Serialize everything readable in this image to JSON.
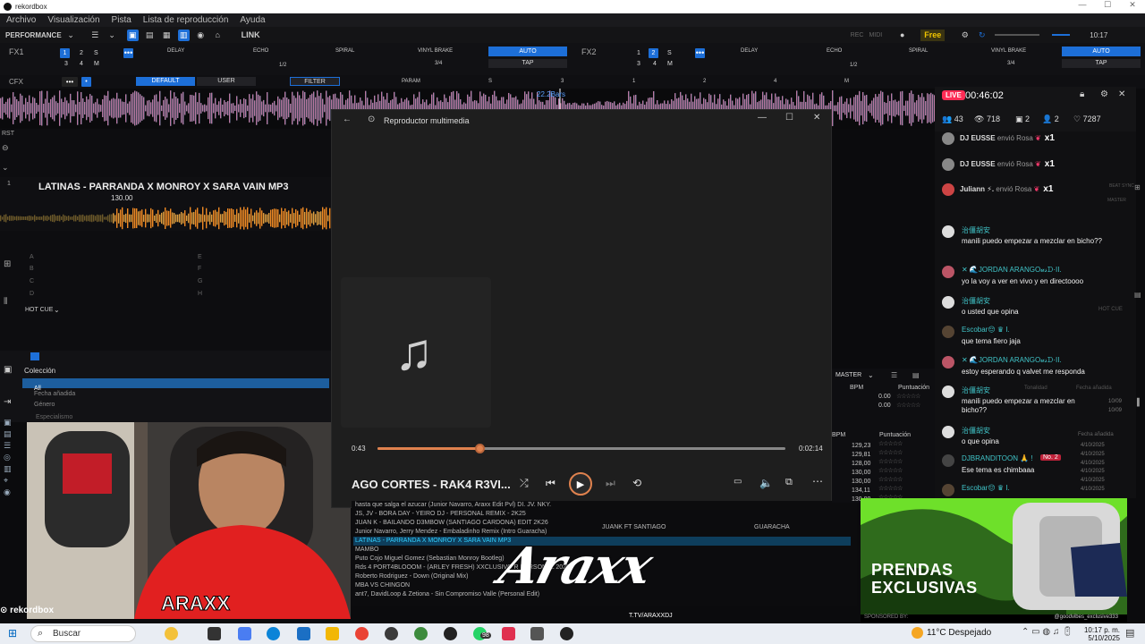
{
  "window": {
    "title": "rekordbox",
    "controls": [
      "—",
      "☐",
      "✕"
    ]
  },
  "menu": [
    "Archivo",
    "Visualización",
    "Pista",
    "Lista de reproducción",
    "Ayuda"
  ],
  "toolbar": {
    "mode": "PERFORMANCE",
    "link": "LINK",
    "free": "Free",
    "time": "10:17",
    "rec_label": "REC",
    "midi_label": "MIDI"
  },
  "fx1": {
    "label": "FX1",
    "effects": [
      "DELAY",
      "ECHO",
      "SPIRAL"
    ],
    "brake": "VINYL BRAKE",
    "auto": "AUTO",
    "tap": "TAP",
    "beat": "1/2",
    "beat2": "3/4",
    "nums": [
      "1",
      "2",
      "S",
      "3",
      "4",
      "M"
    ]
  },
  "fx2": {
    "label": "FX2",
    "effects": [
      "DELAY",
      "ECHO",
      "SPIRAL"
    ],
    "brake": "VINYL BRAKE",
    "auto": "AUTO",
    "tap": "TAP",
    "beat": "1/2",
    "beat2": "3/4"
  },
  "cfx": {
    "label": "CFX",
    "default": "DEFAULT",
    "user": "USER",
    "filter": "FILTER",
    "param": "PARAM",
    "s": "S",
    "m": "M",
    "bars": "22.2Bars",
    "nums": [
      "3",
      "1",
      "2",
      "4"
    ]
  },
  "deck": {
    "number": "1",
    "title": "LATINAS - PARRANDA X MONROY X SARA VAIN MP3",
    "bpm": "130.00",
    "hot_cue": "HOT CUE",
    "ab_left": [
      "A",
      "B",
      "C",
      "D"
    ],
    "ab_right": [
      "E",
      "F",
      "G",
      "H"
    ],
    "rst": "RST"
  },
  "collection": {
    "label": "Colección",
    "items": [
      "All",
      "Fecha añadida",
      "Género"
    ],
    "partial": "Especialismo"
  },
  "player": {
    "title": "Reproductor multimedia",
    "song": "AGO CORTES - RAK4 R3VI...",
    "elapsed": "0:43",
    "total": "0:02:14",
    "progress": 0.25
  },
  "tracklist": {
    "rows": [
      "hasta que salga el azucar (Junior Navarro, Araxx Edit Pvl) DI. JV. NKY.",
      "JS, JV - BORA DAY - YEIRO DJ - PERSONAL REMIX - 2K25",
      "JUAN K - BAILANDO D3MBOW (SANTIAGO CARDONA) EDIT 2K26",
      "Junior Navarro, Jerry Mendez - Embaladinho Remix (Intro Guaracha)",
      "LATINAS - PARRANDA X MONROY X SARA VAIN MP3",
      "MAMBO",
      "Puto Cojo Miguel Gomez (Sebastian Monroy Bootleg)",
      "Rds 4 PORT4BLOOOM - (ARLEY FRESH) XXCLUSIVO R PERSONAL 2025",
      "Roberto Rodriguez - Down (Original Mix)",
      "MBA VS CHINGON",
      "ant7, DavidLoop & Zetiona - Sin Compromiso Valle (Personal Edit)"
    ],
    "selected_index": 4,
    "artist_col": "JUANK FT SANTIAGO",
    "genre_col": "GUARACHA"
  },
  "browser": {
    "master": "MASTER",
    "bpm_header": "BPM",
    "rating_header": "Puntuación",
    "bpm_top": [
      "0.00",
      "0.00"
    ],
    "bpm_values": [
      "129,23",
      "129,81",
      "128,00",
      "130,00",
      "130,00",
      "134,11",
      "130,00"
    ],
    "dates_top": [
      "10/09",
      "10/09"
    ],
    "date_header": "Fecha añadida",
    "dates": [
      "4/10/2025",
      "4/10/2025",
      "4/10/2025",
      "4/10/2025",
      "4/10/2025",
      "4/10/2025",
      "4/10/2025"
    ],
    "tonality_header": "Tonalidad",
    "beat_sync": "BEAT SYNC",
    "master_small": "MASTER"
  },
  "live": {
    "badge": "LIVE",
    "timer": "00:46:02",
    "stats": {
      "viewers": "43",
      "views": "718",
      "shares": "2",
      "users": "2",
      "likes": "7287"
    },
    "gifts": [
      {
        "name": "DJ EUSSE",
        "text": "envió Rosa",
        "count": "x1"
      },
      {
        "name": "DJ EUSSE",
        "text": "envió Rosa",
        "count": "x1"
      },
      {
        "name": "Juliann ⚡.",
        "text": "envió Rosa",
        "count": "x1"
      }
    ],
    "messages": [
      {
        "name": "治僵胡安",
        "text": "manili puedo empezar a mezclar en bicho??"
      },
      {
        "name": "✕ 🌊JORDAN ARANGO𝓊𝓈ᗪ·II.",
        "text": "yo la voy a ver en vivo y en directoooo"
      },
      {
        "name": "治僵胡安",
        "text": "o usted que opina"
      },
      {
        "name": "Escobar😔 ♛ I.",
        "text": "que tema fiero jaja"
      },
      {
        "name": "✕ 🌊JORDAN ARANGO𝓊𝓈ᗪ·II.",
        "text": "estoy esperando q valvet me responda"
      },
      {
        "name": "治僵胡安",
        "text": "manili puedo empezar a mezclar en bicho??"
      },
      {
        "name": "治僵胡安",
        "text": "o que opina"
      },
      {
        "name": "DJBRANDITOON 🙏 !",
        "text": "Ese tema es chimbaaa",
        "badge": "No. 2"
      },
      {
        "name": "Escobar😔 ♛ I.",
        "text": ""
      }
    ],
    "hot_cue": "HOT CUE"
  },
  "ad": {
    "line1": "PRENDAS",
    "line2": "EXCLUSIVAS",
    "sponsored": "SPONSORED BY:",
    "handle": "@goodvibes_exclusive333"
  },
  "overlay": {
    "brand": "rekordbox",
    "signature": "Araxx",
    "channel": "T.TV/ARAXXDJ",
    "shirt_logo": "ARAXX"
  },
  "taskbar": {
    "search": "Buscar",
    "weather": "11°C  Despejado",
    "time": "10:17 p. m.",
    "date": "5/10/2025",
    "whatsapp_badge": "98"
  },
  "colors": {
    "accent": "#1d6fd8",
    "seek": "#e0824e",
    "live": "#fe2c55",
    "selected_row": "#32d0ff"
  }
}
